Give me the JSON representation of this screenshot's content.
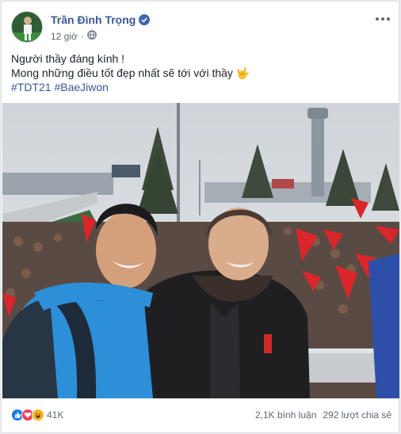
{
  "post": {
    "author": "Trần Đình Trọng",
    "time": "12 giờ",
    "line1": "Người thầy đáng kính !",
    "line2": "Mong những điều tốt đẹp nhất sẽ tới với thầy",
    "line2_emoji": "🤟",
    "tags": [
      "#TDT21",
      "#BaeJiwon"
    ]
  },
  "footer": {
    "reaction_count": "41K",
    "comments": "2,1K bình luận",
    "shares": "292 lượt chia sẻ"
  },
  "colors": {
    "author": "#385898",
    "verified": "#4267b2",
    "like": "#1877f2",
    "love": "#f33e58",
    "haha": "#f7b125"
  },
  "icons": {
    "verified": "check-badge-icon",
    "privacy": "globe-icon",
    "more": "more-dots-icon",
    "like": "like-icon",
    "love": "love-icon",
    "haha": "haha-icon"
  }
}
